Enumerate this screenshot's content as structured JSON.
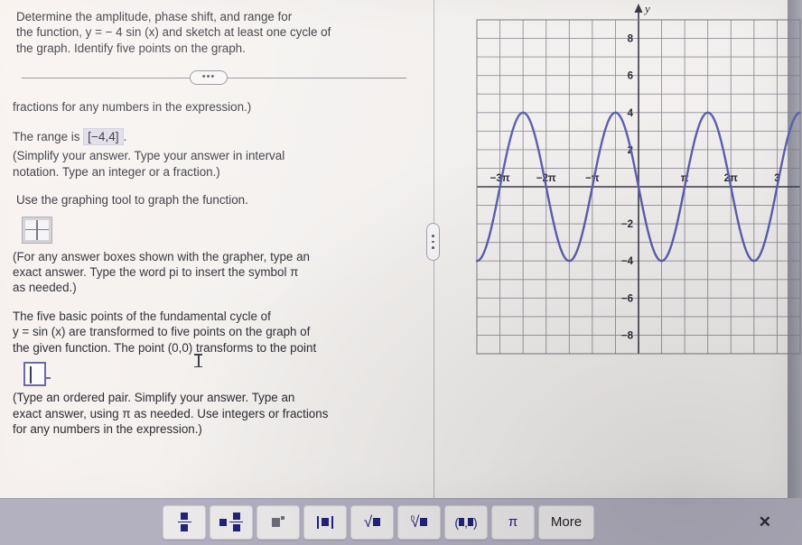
{
  "question": {
    "prompt_lines": [
      "Determine the amplitude, phase shift, and range for",
      "the function, y = − 4 sin (x) and sketch at least one cycle of",
      "the graph. Identify five points on the graph."
    ],
    "continued_instruction": "fractions for any numbers in the expression.)",
    "range_label": "The range is",
    "range_answer": "[−4,4]",
    "range_period": ".",
    "simplify_note_lines": [
      "(Simplify your answer. Type your answer in interval",
      "notation. Type an integer or a fraction.)"
    ],
    "graphing_tool_line": "Use the graphing tool to graph the function.",
    "grapher_note_lines": [
      "(For any answer boxes shown with the grapher, type an",
      "exact answer. Type the word pi to insert the symbol π",
      "as needed.)"
    ],
    "five_points_lines": [
      "The five basic points of the fundamental cycle of",
      "y = sin (x) are transformed to five points on the graph of",
      "the given function. The point (0,0) transforms to the point"
    ],
    "ordered_pair_note_lines": [
      "(Type an ordered pair. Simplify your answer. Type an",
      "exact answer, using π as needed. Use integers or fractions",
      "for any numbers in the expression.)"
    ],
    "point_answer_value": ""
  },
  "divider": {
    "ellipsis_label": "•••"
  },
  "splitter": {
    "grip_label": "drag-handle"
  },
  "palette": {
    "buttons": [
      {
        "name": "fraction-button",
        "label": "■/■"
      },
      {
        "name": "mixed-number-button",
        "label": "■ ■/■"
      },
      {
        "name": "exponent-button",
        "label": "■ʸ"
      },
      {
        "name": "absolute-value-button",
        "label": "|■|"
      },
      {
        "name": "square-root-button",
        "label": "√■"
      },
      {
        "name": "nth-root-button",
        "label": "ⁿ√■"
      },
      {
        "name": "ordered-pair-button",
        "label": "(■,■)"
      },
      {
        "name": "pi-button",
        "label": "π"
      },
      {
        "name": "more-button",
        "label": "More"
      }
    ],
    "close_label": "✕"
  },
  "chart_data": {
    "type": "line",
    "title": "",
    "xlabel": "",
    "ylabel": "y",
    "function": "y = -4 sin(x)",
    "amplitude": 4,
    "period": 6.283185307179586,
    "xlim": [
      -10.995574,
      10.995574
    ],
    "ylim": [
      -9,
      9
    ],
    "x_tick_labels": [
      "−3π",
      "−2π",
      "−π",
      "π",
      "2π",
      "3"
    ],
    "x_tick_values": [
      -9.42477796,
      -6.28318531,
      -3.14159265,
      3.14159265,
      6.28318531,
      9.42477796
    ],
    "y_tick_labels": [
      "8",
      "6",
      "4",
      "2",
      "−2",
      "−4",
      "−6",
      "−8"
    ],
    "y_tick_values": [
      8,
      6,
      4,
      2,
      -2,
      -4,
      -6,
      -8
    ],
    "grid": true,
    "grid_spacing_x": 1.5707963,
    "grid_spacing_y": 1,
    "curve_color": "#5b5fae",
    "axis_color": "#3a3a46",
    "grid_color": "#7e7e8a",
    "legend": "",
    "key_points": [
      {
        "x": -9.42477796,
        "y": 0
      },
      {
        "x": -7.85398163,
        "y": 4
      },
      {
        "x": -6.28318531,
        "y": 0
      },
      {
        "x": -4.71238898,
        "y": -4
      },
      {
        "x": -3.14159265,
        "y": 0
      },
      {
        "x": -1.57079633,
        "y": 4
      },
      {
        "x": 0,
        "y": 0
      },
      {
        "x": 1.57079633,
        "y": -4
      },
      {
        "x": 3.14159265,
        "y": 0
      },
      {
        "x": 4.71238898,
        "y": 4
      },
      {
        "x": 6.28318531,
        "y": 0
      },
      {
        "x": 7.85398163,
        "y": -4
      },
      {
        "x": 9.42477796,
        "y": 0
      }
    ]
  }
}
